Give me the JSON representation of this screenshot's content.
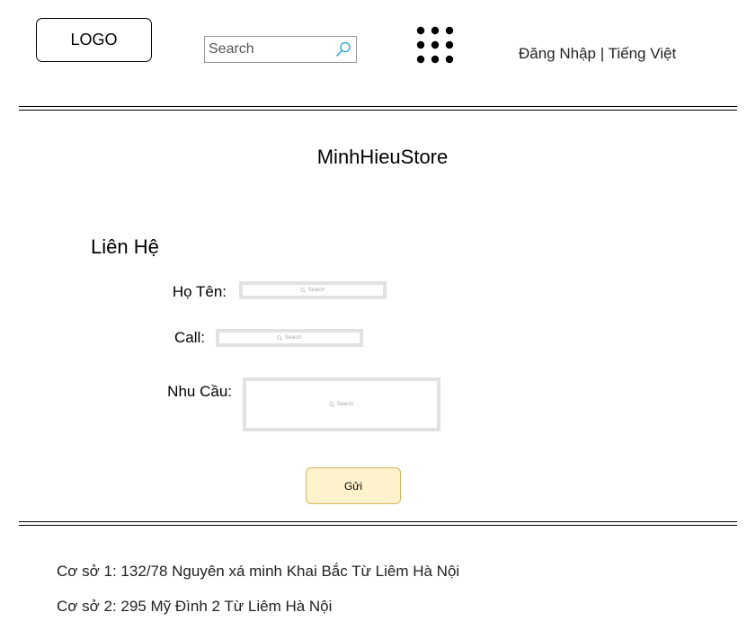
{
  "header": {
    "logo_text": "LOGO",
    "search_placeholder": "Search",
    "menu_icon": "grid-dots-icon",
    "login_label": "Đăng Nhập",
    "separator": "|",
    "language_label": "Tiếng Việt"
  },
  "main": {
    "store_title": "MinhHieuStore",
    "section_title": "Liên Hệ",
    "form": {
      "name_label": "Họ Tên:",
      "name_placeholder": "Search",
      "call_label": "Call:",
      "call_placeholder": "Search",
      "needs_label": "Nhu Cầu:",
      "needs_placeholder": "Search",
      "submit_label": "Gửi"
    }
  },
  "footer": {
    "address_1": "Cơ sở 1: 132/78 Nguyên xá minh Khai Bắc Từ Liêm Hà Nội",
    "address_2": "Cơ sở 2: 295 Mỹ Đình 2 Từ Liêm Hà Nội"
  },
  "colors": {
    "button_fill": "#fff2cc",
    "button_border": "#d6b656",
    "search_icon": "#1ba1e2",
    "input_border": "#e2e2e2"
  }
}
